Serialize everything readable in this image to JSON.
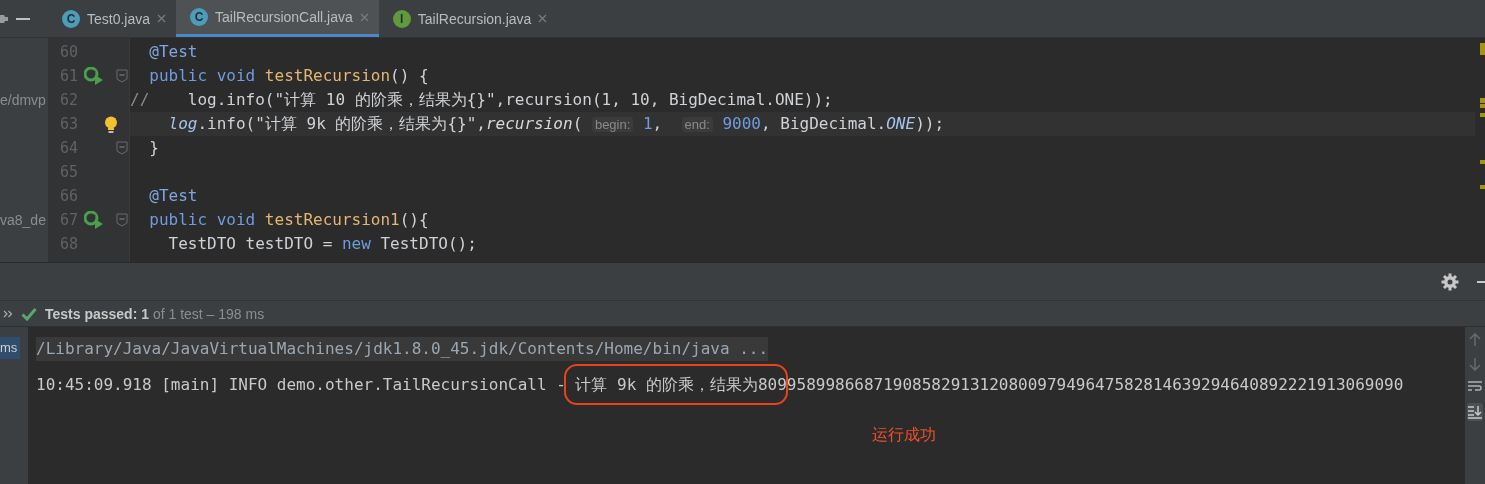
{
  "tabs": [
    {
      "label": "Test0.java",
      "kind": "class",
      "icon_letter": "C",
      "selected": false
    },
    {
      "label": "TailRecursionCall.java",
      "kind": "class",
      "icon_letter": "C",
      "selected": true
    },
    {
      "label": "TailRecursion.java",
      "kind": "interface",
      "icon_letter": "I",
      "selected": false
    }
  ],
  "project_tree": [
    "e/dmvp",
    "va8_de"
  ],
  "editor": {
    "lines": [
      {
        "number": "60",
        "run_icon": false,
        "fold": false,
        "current": false,
        "bulb": false,
        "tokens": [
          {
            "kind": "annotation",
            "text": "  @Test"
          }
        ]
      },
      {
        "number": "61",
        "run_icon": true,
        "fold": true,
        "current": false,
        "bulb": false,
        "tokens": [
          {
            "kind": "keyword",
            "text": "  public void "
          },
          {
            "kind": "method",
            "text": "testRecursion"
          },
          {
            "kind": "plain",
            "text": "() {"
          }
        ]
      },
      {
        "number": "62",
        "run_icon": false,
        "fold": false,
        "current": false,
        "bulb": false,
        "tokens": [
          {
            "kind": "comment",
            "text": "//"
          },
          {
            "kind": "plain",
            "text": "    log.info(\"计算 10 的阶乘，结果为{}\",recursion(1, 10, BigDecimal.ONE));"
          }
        ]
      },
      {
        "number": "63",
        "run_icon": false,
        "fold": false,
        "current": true,
        "bulb": true,
        "tokens": [
          {
            "kind": "field",
            "text": "    log"
          },
          {
            "kind": "plain",
            "text": ".info(\"计算 9k 的阶乘，结果为{}\","
          },
          {
            "kind": "call",
            "text": "recursion"
          },
          {
            "kind": "plain",
            "text": "( "
          },
          {
            "kind": "hint",
            "text": "begin:"
          },
          {
            "kind": "number",
            "text": " 1"
          },
          {
            "kind": "plain",
            "text": ",  "
          },
          {
            "kind": "hint",
            "text": "end:"
          },
          {
            "kind": "number",
            "text": " 9000"
          },
          {
            "kind": "plain",
            "text": ", BigDecimal."
          },
          {
            "kind": "field",
            "text": "ONE"
          },
          {
            "kind": "plain",
            "text": "));"
          }
        ]
      },
      {
        "number": "64",
        "run_icon": false,
        "fold": true,
        "current": false,
        "bulb": false,
        "tokens": [
          {
            "kind": "plain",
            "text": "  }"
          }
        ]
      },
      {
        "number": "65",
        "run_icon": false,
        "fold": false,
        "current": false,
        "bulb": false
      },
      {
        "number": "66",
        "run_icon": false,
        "fold": false,
        "current": false,
        "bulb": false,
        "tokens": [
          {
            "kind": "annotation",
            "text": "  @Test"
          }
        ]
      },
      {
        "number": "67",
        "run_icon": true,
        "fold": true,
        "current": false,
        "bulb": false,
        "tokens": [
          {
            "kind": "keyword",
            "text": "  public void "
          },
          {
            "kind": "method",
            "text": "testRecursion1"
          },
          {
            "kind": "plain",
            "text": "(){"
          }
        ]
      },
      {
        "number": "68",
        "run_icon": false,
        "fold": false,
        "current": false,
        "bulb": false,
        "tokens": [
          {
            "kind": "plain",
            "text": "    TestDTO testDTO = "
          },
          {
            "kind": "keyword",
            "text": "new"
          },
          {
            "kind": "plain",
            "text": " TestDTO();"
          }
        ]
      }
    ]
  },
  "run_panel": {
    "passed": true,
    "summary": "**Tests passed: 1** of 1 test – 198 ms",
    "console_badge": "ms",
    "console": [
      {
        "kind": "command",
        "text": "/Library/Java/JavaVirtualMachines/jdk1.8.0_45.jdk/Contents/Home/bin/java ..."
      },
      {
        "kind": "log",
        "text": "10:45:09.918 [main] INFO demo.other.TailRecursionCall - 计算 9k 的阶乘，结果为8099589986687190858291312080097949647582814639294640892221913069090"
      }
    ],
    "annotation": "运行成功"
  }
}
